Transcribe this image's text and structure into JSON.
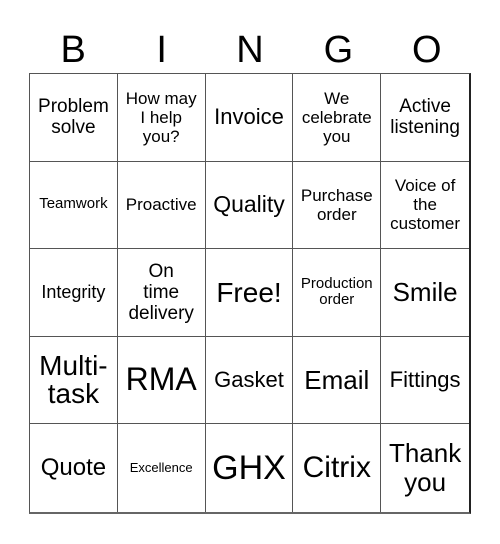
{
  "header": {
    "letters": [
      "B",
      "I",
      "N",
      "G",
      "O"
    ]
  },
  "rows": [
    [
      "Problem solve",
      "How may I help you?",
      "Invoice",
      "We celebrate you",
      "Active listening"
    ],
    [
      "Teamwork",
      "Proactive",
      "Quality",
      "Purchase order",
      "Voice of the customer"
    ],
    [
      "Integrity",
      "On time delivery",
      "Free!",
      "Production order",
      "Smile"
    ],
    [
      "Multi-task",
      "RMA",
      "Gasket",
      "Email",
      "Fittings"
    ],
    [
      "Quote",
      "Excellence",
      "GHX",
      "Citrix",
      "Thank you"
    ]
  ],
  "cells_display": {
    "r0c0": [
      "Problem",
      "solve"
    ],
    "r0c1": [
      "How may",
      "I help",
      "you?"
    ],
    "r0c3": [
      "We",
      "celebrate",
      "you"
    ],
    "r0c4": [
      "Active",
      "listening"
    ],
    "r1c3": [
      "Purchase",
      "order"
    ],
    "r1c4": [
      "Voice of",
      "the",
      "customer"
    ],
    "r2c1": [
      "On",
      "time",
      "delivery"
    ],
    "r2c3": [
      "Production",
      "order"
    ],
    "r3c0": [
      "Multi-",
      "task"
    ],
    "r4c4": [
      "Thank",
      "you"
    ]
  },
  "free_space": {
    "row": 2,
    "col": 2,
    "label": "Free!"
  }
}
